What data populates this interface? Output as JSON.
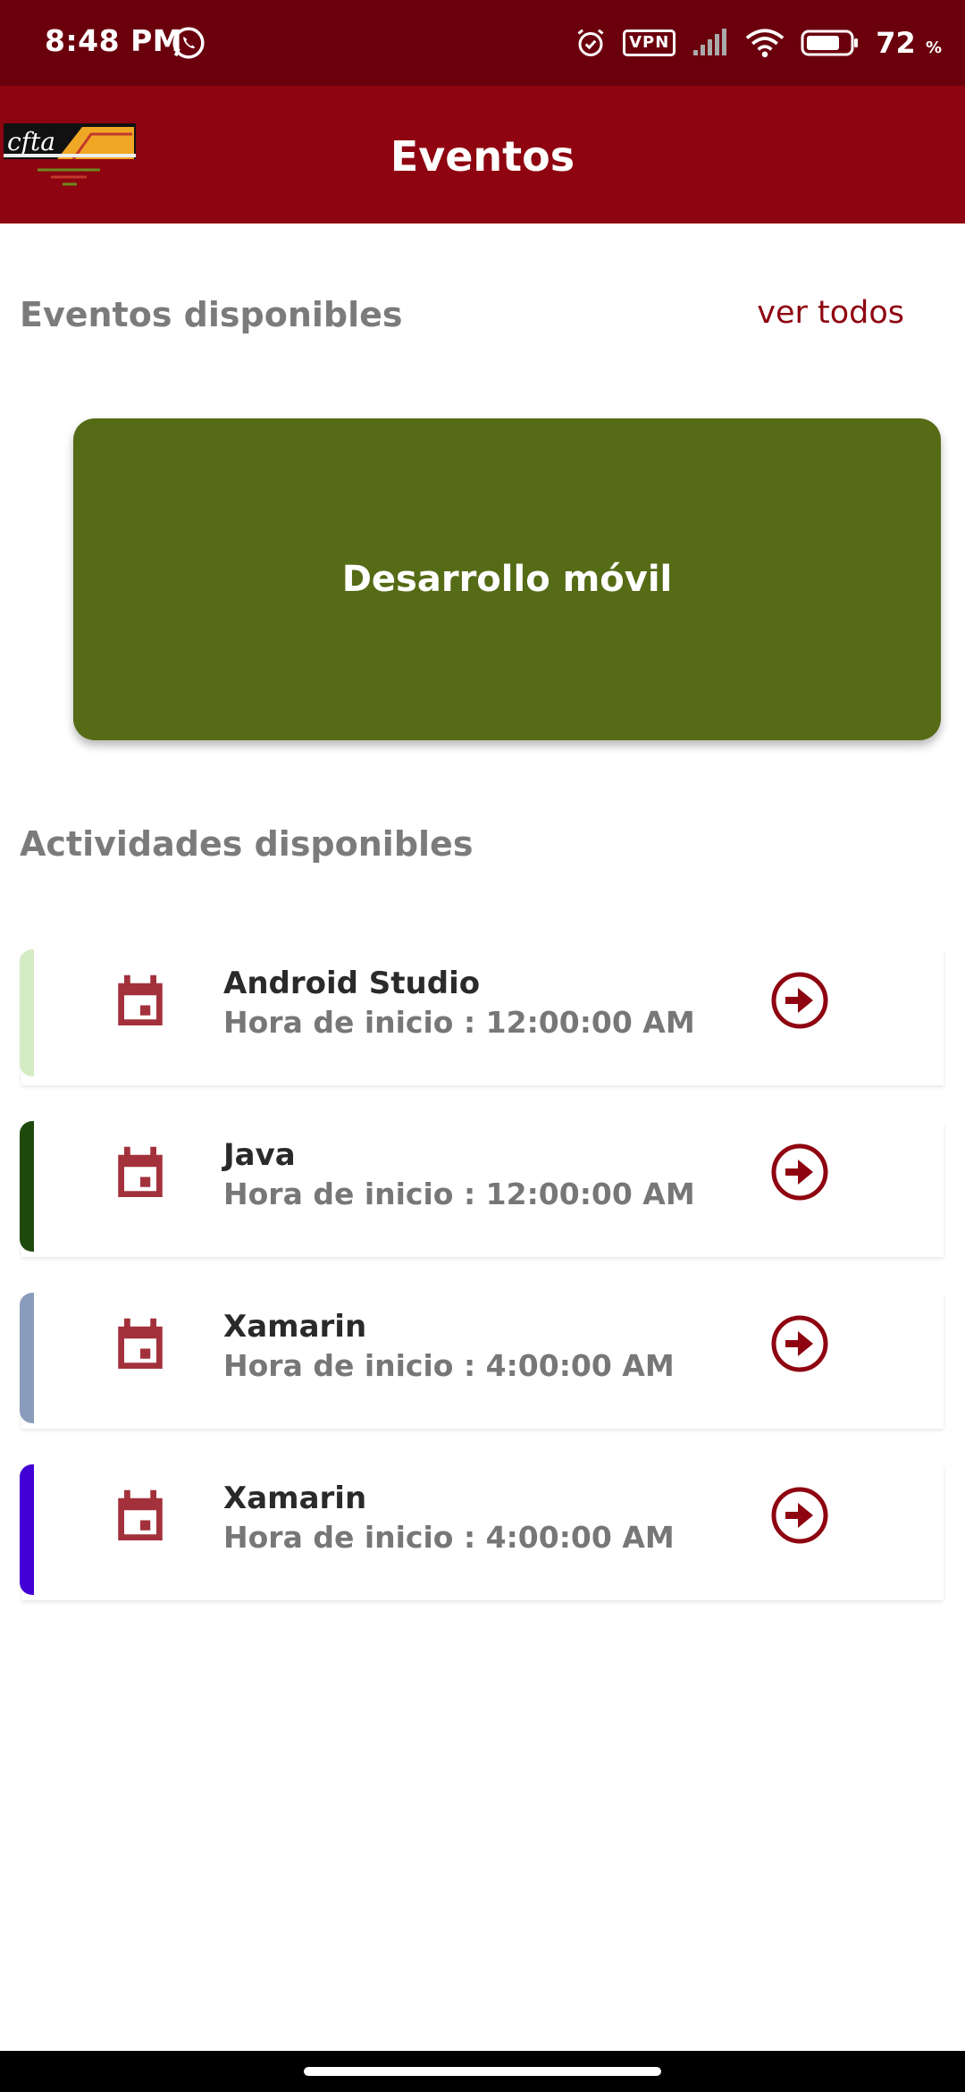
{
  "status_bar": {
    "time": "8:48 PM",
    "vpn": "VPN",
    "battery": "72",
    "battery_unit": "%"
  },
  "app_bar": {
    "title": "Eventos",
    "logo_text": "cfta"
  },
  "events_section": {
    "title": "Eventos disponibles",
    "see_all": "ver todos",
    "featured": {
      "name": "Desarrollo móvil",
      "color": "#556b16"
    }
  },
  "activities_section": {
    "title": "Actividades disponibles",
    "items": [
      {
        "name": "Android Studio",
        "start_label": "Hora de inicio : 12:00:00 AM",
        "accent": "#d4ebc4"
      },
      {
        "name": "Java",
        "start_label": "Hora de inicio : 12:00:00 AM",
        "accent": "#1f4a0e"
      },
      {
        "name": "Xamarin",
        "start_label": "Hora de inicio : 4:00:00 AM",
        "accent": "#8a9cbc"
      },
      {
        "name": "Xamarin",
        "start_label": "Hora de inicio : 4:00:00 AM",
        "accent": "#4300d6"
      }
    ]
  },
  "colors": {
    "primary": "#8e0410",
    "status_bar": "#6b000d",
    "icon": "#a3313b"
  }
}
